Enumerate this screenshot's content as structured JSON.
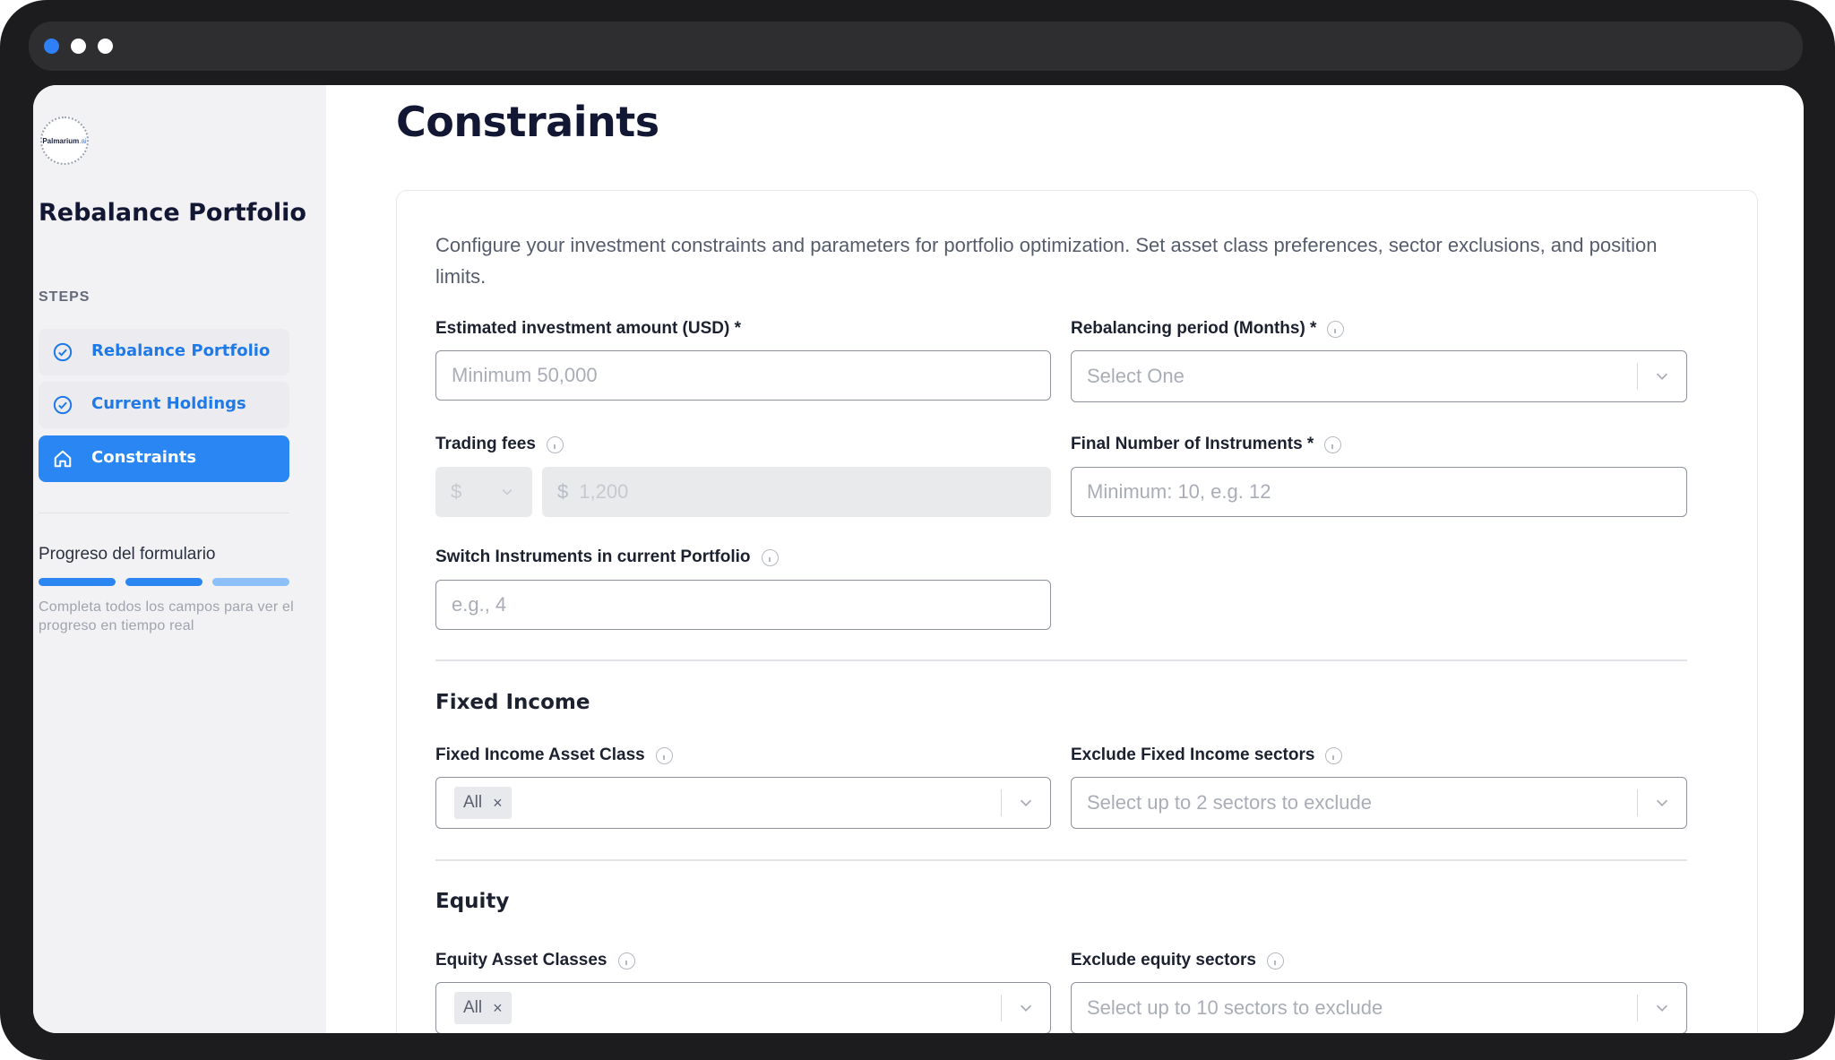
{
  "window": {
    "dots": [
      "#2f7ff6",
      "#ffffff",
      "#ffffff"
    ]
  },
  "sidebar": {
    "logo_text": "Palmarium",
    "logo_suffix": ".ai",
    "title": "Rebalance Portfolio",
    "steps_label": "STEPS",
    "steps": [
      {
        "label": "Rebalance Portfolio",
        "icon": "check-circle-icon",
        "state": "done"
      },
      {
        "label": "Current Holdings",
        "icon": "check-circle-icon",
        "state": "done"
      },
      {
        "label": "Constraints",
        "icon": "home-icon",
        "state": "active"
      }
    ],
    "progress_title": "Progreso del formulario",
    "progress_segments": [
      "complete",
      "complete",
      "partial"
    ],
    "progress_hint": "Completa todos los campos para ver el progreso en tiempo real"
  },
  "main": {
    "title": "Constraints",
    "description": "Configure your investment constraints and parameters for portfolio optimization. Set asset class preferences, sector exclusions, and position limits.",
    "fields": {
      "investment_amount": {
        "label": "Estimated investment amount (USD) *",
        "placeholder": "Minimum 50,000"
      },
      "rebalancing_period": {
        "label": "Rebalancing period (Months) *",
        "placeholder": "Select One"
      },
      "trading_fees": {
        "label": "Trading fees",
        "currency": "$",
        "prefix": "$",
        "placeholder": "1,200"
      },
      "final_instruments": {
        "label": "Final Number of Instruments *",
        "placeholder": "Minimum: 10, e.g. 12"
      },
      "switch_instruments": {
        "label": "Switch Instruments in current Portfolio",
        "placeholder": "e.g., 4"
      }
    },
    "fixed_income": {
      "title": "Fixed Income",
      "asset_class_label": "Fixed Income Asset Class",
      "asset_class_tag": "All",
      "exclude_label": "Exclude Fixed Income sectors",
      "exclude_placeholder": "Select up to 2 sectors to exclude"
    },
    "equity": {
      "title": "Equity",
      "asset_class_label": "Equity Asset Classes",
      "asset_class_tag": "All",
      "exclude_label": "Exclude equity sectors",
      "exclude_placeholder": "Select up to 10 sectors to exclude"
    },
    "tag_remove": "×"
  }
}
